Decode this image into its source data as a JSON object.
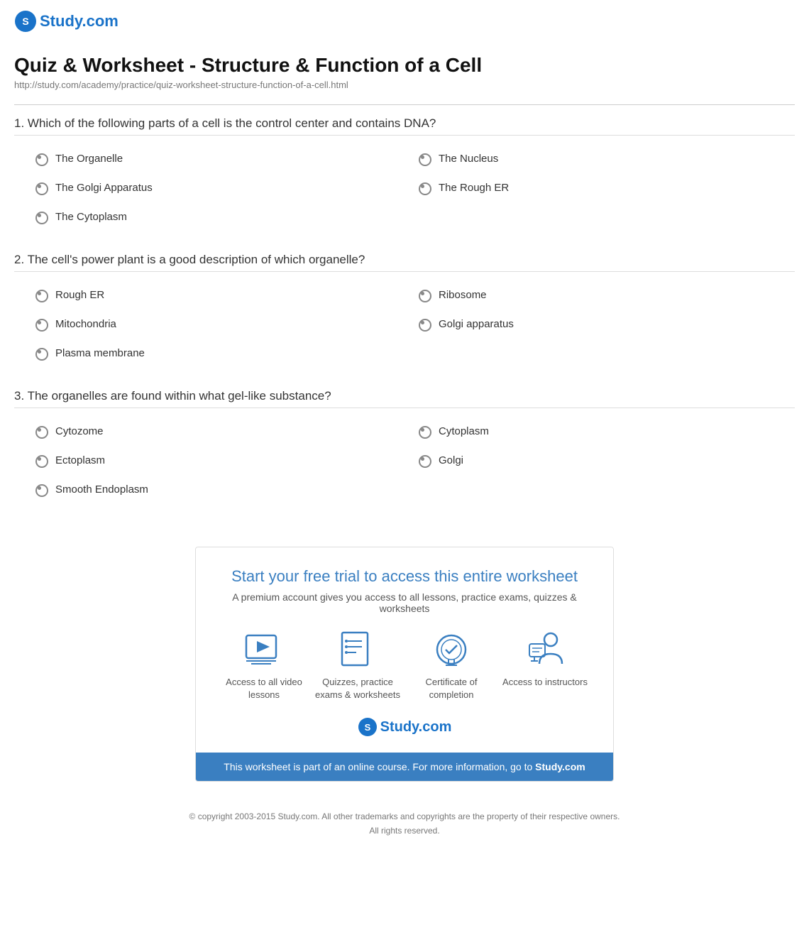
{
  "logo": {
    "text": "Study.com",
    "url_text": "study.com"
  },
  "page": {
    "title": "Quiz & Worksheet - Structure & Function of a Cell",
    "url": "http://study.com/academy/practice/quiz-worksheet-structure-function-of-a-cell.html"
  },
  "questions": [
    {
      "number": "1",
      "text": "Which of the following parts of a cell is the control center and contains DNA?",
      "options": [
        {
          "label": "The Organelle",
          "col": 1
        },
        {
          "label": "The Nucleus",
          "col": 2
        },
        {
          "label": "The Golgi Apparatus",
          "col": 1
        },
        {
          "label": "The Rough ER",
          "col": 2
        },
        {
          "label": "The Cytoplasm",
          "col": 1
        }
      ]
    },
    {
      "number": "2",
      "text": "The cell's power plant is a good description of which organelle?",
      "options": [
        {
          "label": "Rough ER",
          "col": 1
        },
        {
          "label": "Ribosome",
          "col": 2
        },
        {
          "label": "Mitochondria",
          "col": 1
        },
        {
          "label": "Golgi apparatus",
          "col": 2
        },
        {
          "label": "Plasma membrane",
          "col": 1
        }
      ]
    },
    {
      "number": "3",
      "text": "The organelles are found within what gel-like substance?",
      "options": [
        {
          "label": "Cytozome",
          "col": 1
        },
        {
          "label": "Cytoplasm",
          "col": 2
        },
        {
          "label": "Ectoplasm",
          "col": 1
        },
        {
          "label": "Golgi",
          "col": 2
        },
        {
          "label": "Smooth Endoplasm",
          "col": 1
        }
      ]
    }
  ],
  "cta": {
    "title": "Start your free trial to access this entire worksheet",
    "subtitle": "A premium account gives you access to all lessons, practice exams, quizzes & worksheets",
    "features": [
      {
        "icon": "video-icon",
        "label": "Access to all video lessons"
      },
      {
        "icon": "quiz-icon",
        "label": "Quizzes, practice exams & worksheets"
      },
      {
        "icon": "certificate-icon",
        "label": "Certificate of completion"
      },
      {
        "icon": "instructor-icon",
        "label": "Access to instructors"
      }
    ],
    "footer_text": "This worksheet is part of an online course. For more information, go to ",
    "footer_link": "Study.com"
  },
  "copyright": {
    "line1": "© copyright 2003-2015 Study.com. All other trademarks and copyrights are the property of their respective owners.",
    "line2": "All rights reserved."
  }
}
